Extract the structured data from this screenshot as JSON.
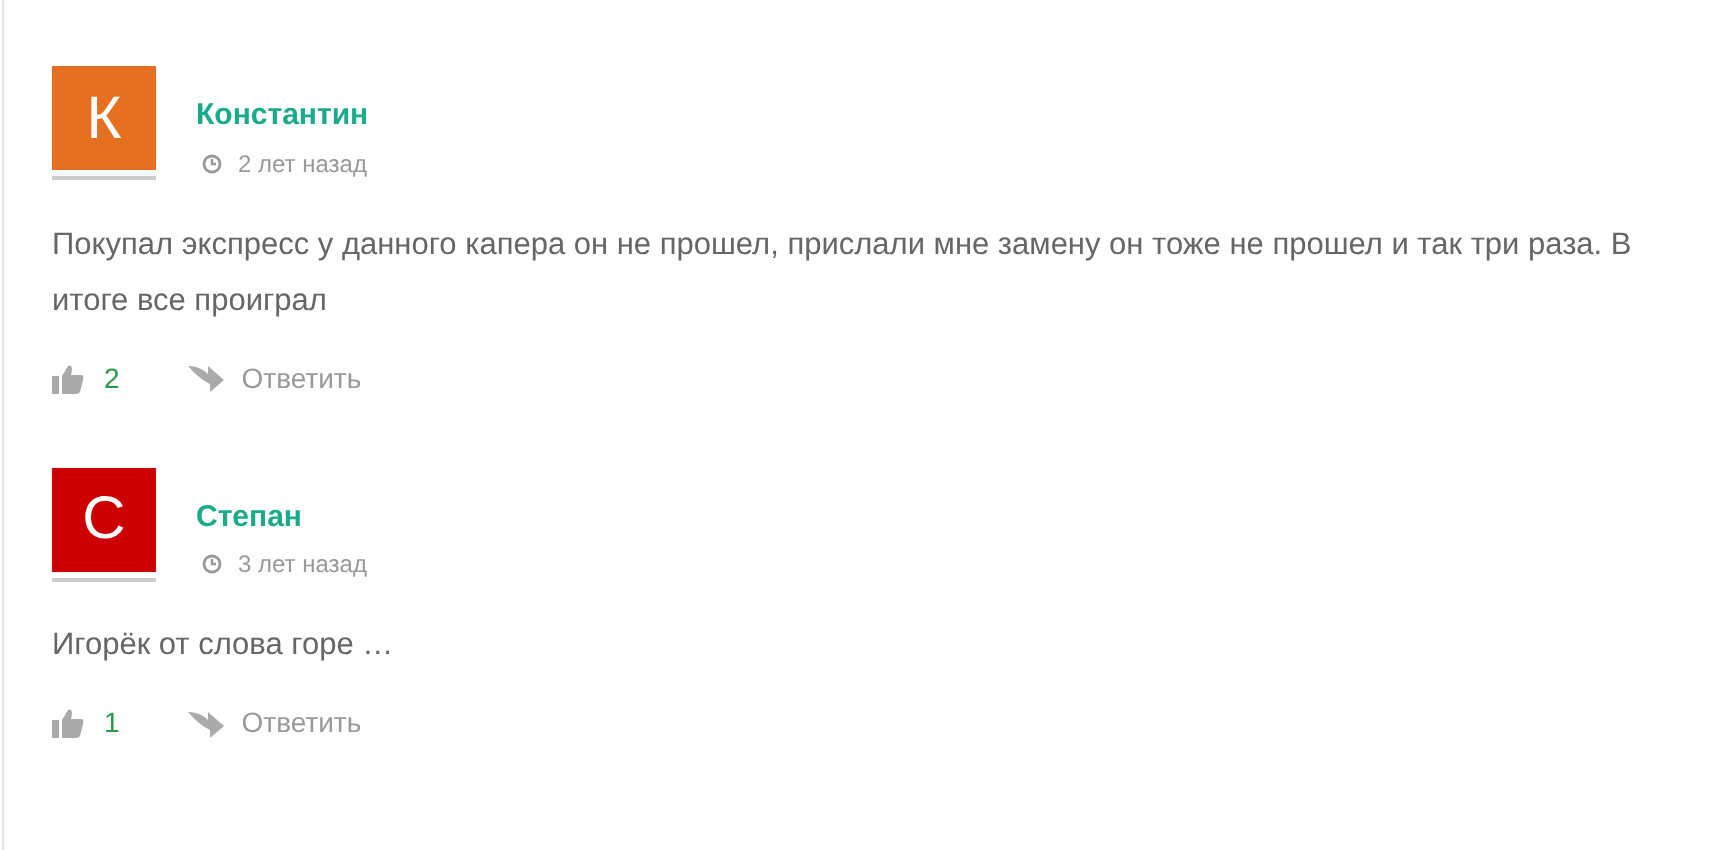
{
  "comments": [
    {
      "avatar_letter": "К",
      "color": "#e67021",
      "author": "Константин",
      "time": "2 лет назад",
      "text": "Покупал экспресс у данного капера он не прошел, прислали мне замену он тоже не прошел и так три раза. В итоге все проиграл",
      "likes": "2",
      "reply": "Ответить"
    },
    {
      "avatar_letter": "С",
      "color": "#cc0000",
      "author": "Степан",
      "time": "3 лет назад",
      "text": "Игорёк от слова горе …",
      "likes": "1",
      "reply": "Ответить"
    }
  ]
}
